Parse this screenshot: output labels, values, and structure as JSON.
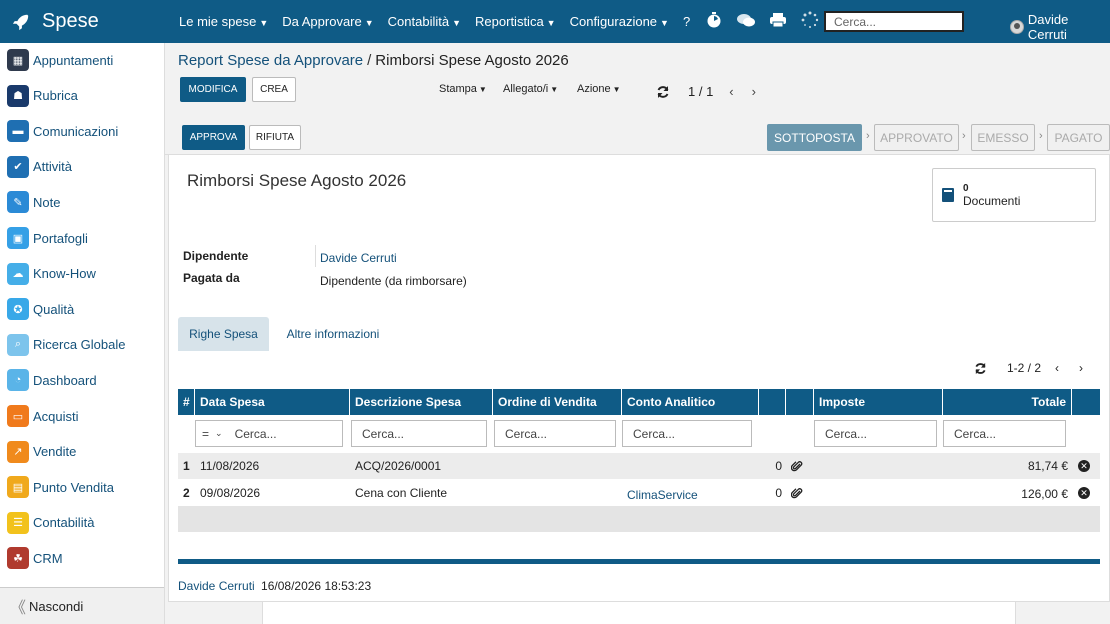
{
  "app": {
    "title": "Spese",
    "menu": [
      {
        "label": "Le mie spese",
        "has_dropdown": true
      },
      {
        "label": "Da Approvare",
        "has_dropdown": true
      },
      {
        "label": "Contabilità",
        "has_dropdown": true
      },
      {
        "label": "Reportistica",
        "has_dropdown": true
      },
      {
        "label": "Configurazione",
        "has_dropdown": true
      },
      {
        "label": "?",
        "has_dropdown": false
      }
    ],
    "search_placeholder": "Cerca...",
    "user_name": "Davide Cerruti",
    "colors": {
      "primary": "#0f5b86",
      "link": "#14517a",
      "status_current": "#6a97ad"
    }
  },
  "sidebar": {
    "items": [
      {
        "label": "Appuntamenti",
        "icon": "calendar-icon",
        "color": "#2f3a4d"
      },
      {
        "label": "Rubrica",
        "icon": "contacts-icon",
        "color": "#1a3a6b"
      },
      {
        "label": "Comunicazioni",
        "icon": "chat-icon",
        "color": "#1f6fb2"
      },
      {
        "label": "Attività",
        "icon": "checkbox-icon",
        "color": "#1f6fb2"
      },
      {
        "label": "Note",
        "icon": "note-icon",
        "color": "#2b8ad6"
      },
      {
        "label": "Portafogli",
        "icon": "lock-icon",
        "color": "#35a0e6"
      },
      {
        "label": "Know-How",
        "icon": "brain-icon",
        "color": "#45aee8"
      },
      {
        "label": "Qualità",
        "icon": "quality-icon",
        "color": "#38a8e8"
      },
      {
        "label": "Ricerca Globale",
        "icon": "search-icon",
        "color": "#7dc4ec"
      },
      {
        "label": "Dashboard",
        "icon": "gauge-icon",
        "color": "#5ab4e8"
      },
      {
        "label": "Acquisti",
        "icon": "purchases-icon",
        "color": "#f07a1c"
      },
      {
        "label": "Vendite",
        "icon": "chart-icon",
        "color": "#f08a1c"
      },
      {
        "label": "Punto Vendita",
        "icon": "pos-icon",
        "color": "#f0a91c"
      },
      {
        "label": "Contabilità",
        "icon": "accounting-icon",
        "color": "#f2c21c"
      },
      {
        "label": "CRM",
        "icon": "handshake-icon",
        "color": "#b03a2e"
      }
    ],
    "footer_label": "Nascondi"
  },
  "control": {
    "breadcrumb_parent": "Report Spese da Approvare",
    "breadcrumb_sep": "/",
    "breadcrumb_current": "Rimborsi Spese Agosto 2026",
    "edit_label": "MODIFICA",
    "create_label": "CREA",
    "print_label": "Stampa",
    "attachment_label": "Allegato/i",
    "action_label": "Azione",
    "record_pager": "1 / 1"
  },
  "statusbar": {
    "approve_label": "APPROVA",
    "refuse_label": "RIFIUTA",
    "stages": [
      "SOTTOPOSTA",
      "APPROVATO",
      "EMESSO",
      "PAGATO"
    ],
    "current_stage": "SOTTOPOSTA"
  },
  "form": {
    "title": "Rimborsi Spese Agosto 2026",
    "documents_count": "0",
    "documents_label": "Documenti",
    "employee_label": "Dipendente",
    "employee_value": "Davide Cerruti",
    "paid_by_label": "Pagata da",
    "paid_by_value": "Dipendente (da rimborsare)",
    "tabs": [
      "Righe Spesa",
      "Altre informazioni"
    ]
  },
  "lines": {
    "pager": "1-2 / 2",
    "columns": [
      "#",
      "Data Spesa",
      "Descrizione Spesa",
      "Ordine di Vendita",
      "Conto Analitico",
      "",
      "",
      "Imposte",
      "Totale",
      ""
    ],
    "filter_operator": "=",
    "filter_placeholder": "Cerca...",
    "rows": [
      {
        "num": "1",
        "date": "11/08/2026",
        "description": "ACQ/2026/0001",
        "sale_order": "",
        "analytic": "",
        "attachments": "0",
        "taxes": "",
        "total": "81,74 €"
      },
      {
        "num": "2",
        "date": "09/08/2026",
        "description": "Cena con Cliente",
        "sale_order": "",
        "analytic": "ClimaService",
        "attachments": "0",
        "taxes": "",
        "total": "126,00 €"
      }
    ]
  },
  "audit": {
    "user": "Davide Cerruti",
    "timestamp": "16/08/2026 18:53:23"
  }
}
